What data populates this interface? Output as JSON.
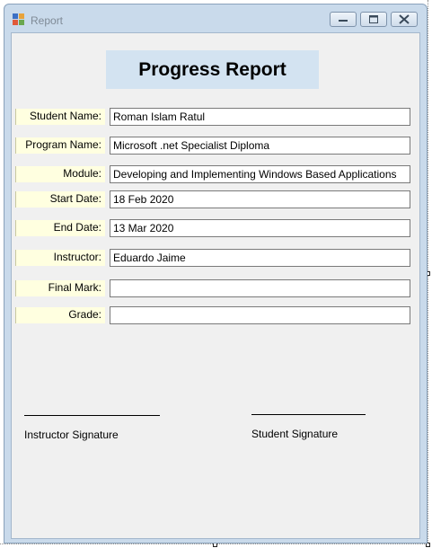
{
  "window": {
    "title": "Report"
  },
  "report": {
    "heading": "Progress Report"
  },
  "fields": [
    {
      "label": "Student Name:",
      "value": "Roman Islam Ratul"
    },
    {
      "label": "Program Name:",
      "value": "Microsoft .net Specialist Diploma"
    },
    {
      "label": "Module:",
      "value": "Developing and Implementing Windows Based Applications"
    },
    {
      "label": "Start Date:",
      "value": "18 Feb 2020"
    },
    {
      "label": "End Date:",
      "value": "13 Mar 2020"
    },
    {
      "label": "Instructor:",
      "value": "Eduardo Jaime"
    },
    {
      "label": "Final Mark:",
      "value": ""
    },
    {
      "label": "Grade:",
      "value": ""
    }
  ],
  "signatures": {
    "instructor": "Instructor Signature",
    "student": "Student Signature"
  }
}
